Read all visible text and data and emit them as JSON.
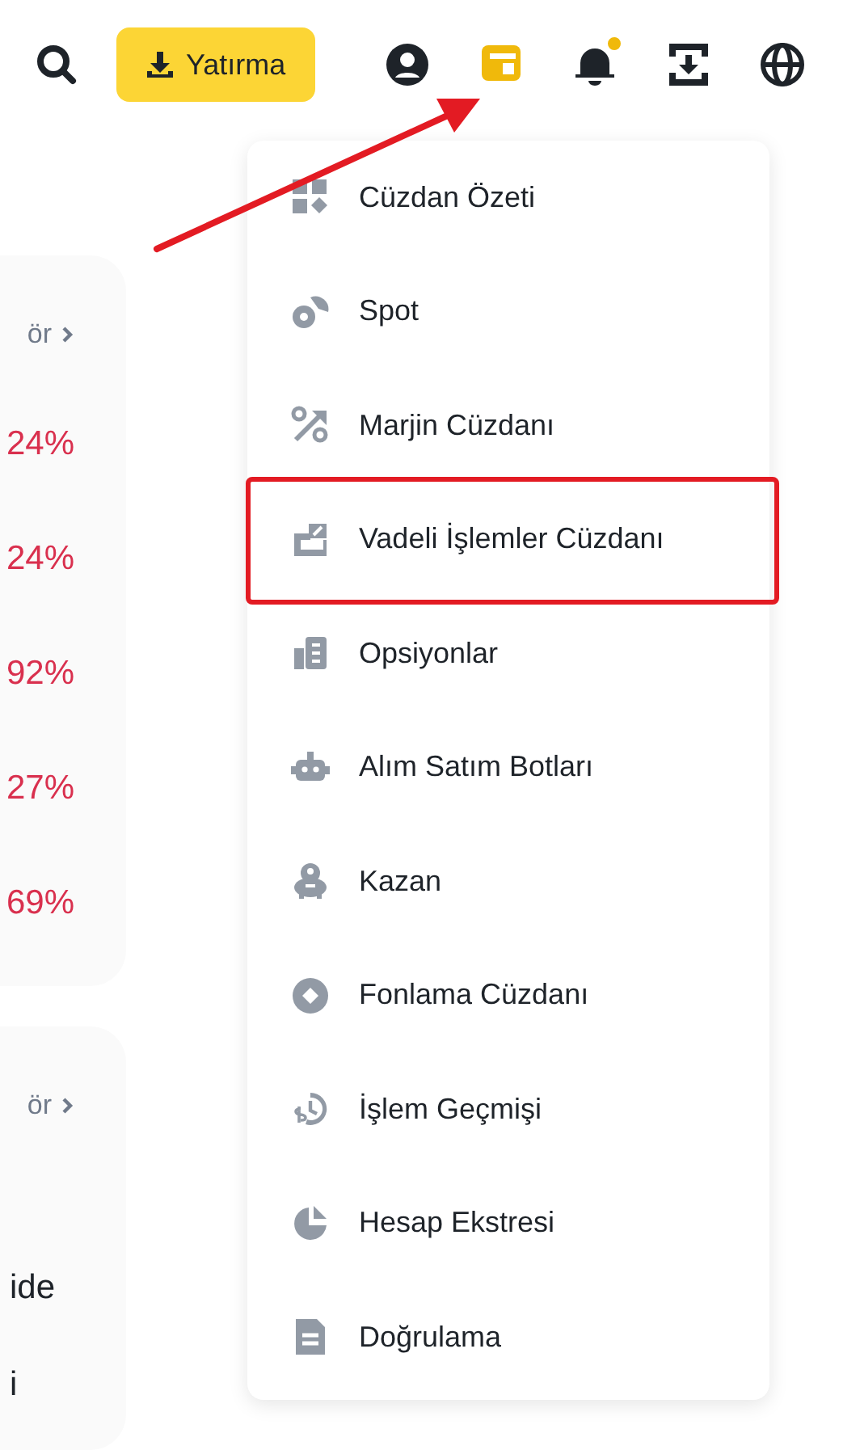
{
  "top_bar": {
    "deposit_button": {
      "label": "Yatırma"
    },
    "icons": [
      {
        "kind": "user",
        "active": false,
        "badge": false
      },
      {
        "kind": "wallet",
        "active": true,
        "badge": false
      },
      {
        "kind": "bell",
        "active": false,
        "badge": true
      },
      {
        "kind": "transfer",
        "active": false,
        "badge": false
      },
      {
        "kind": "globe",
        "active": false,
        "badge": false
      }
    ]
  },
  "cards": [
    {
      "link": "ör",
      "lines": [
        {
          "kind": "change",
          "text": "24%"
        },
        {
          "kind": "change",
          "text": "24%"
        },
        {
          "kind": "change",
          "text": "92%"
        },
        {
          "kind": "change",
          "text": "27%"
        },
        {
          "kind": "change",
          "text": "69%"
        }
      ]
    },
    {
      "link": "ör",
      "lines": [
        {
          "kind": "name",
          "text": "ide"
        },
        {
          "kind": "name",
          "text": "i"
        }
      ]
    }
  ],
  "wallet_menu": {
    "items": [
      {
        "label": "Cüzdan Özeti",
        "kind": "overview",
        "highlighted": false
      },
      {
        "label": "Spot",
        "kind": "spot",
        "highlighted": false
      },
      {
        "label": "Marjin Cüzdanı",
        "kind": "margin",
        "highlighted": false
      },
      {
        "label": "Vadeli İşlemler Cüzdanı",
        "kind": "futures",
        "highlighted": true
      },
      {
        "label": "Opsiyonlar",
        "kind": "options",
        "highlighted": false
      },
      {
        "label": "Alım Satım Botları",
        "kind": "bot",
        "highlighted": false
      },
      {
        "label": "Kazan",
        "kind": "earn",
        "highlighted": false
      },
      {
        "label": "Fonlama Cüzdanı",
        "kind": "funding",
        "highlighted": false
      },
      {
        "label": "İşlem Geçmişi",
        "kind": "history",
        "highlighted": false
      },
      {
        "label": "Hesap Ekstresi",
        "kind": "statement",
        "highlighted": false
      },
      {
        "label": "Doğrulama",
        "kind": "verification",
        "highlighted": false
      }
    ]
  }
}
